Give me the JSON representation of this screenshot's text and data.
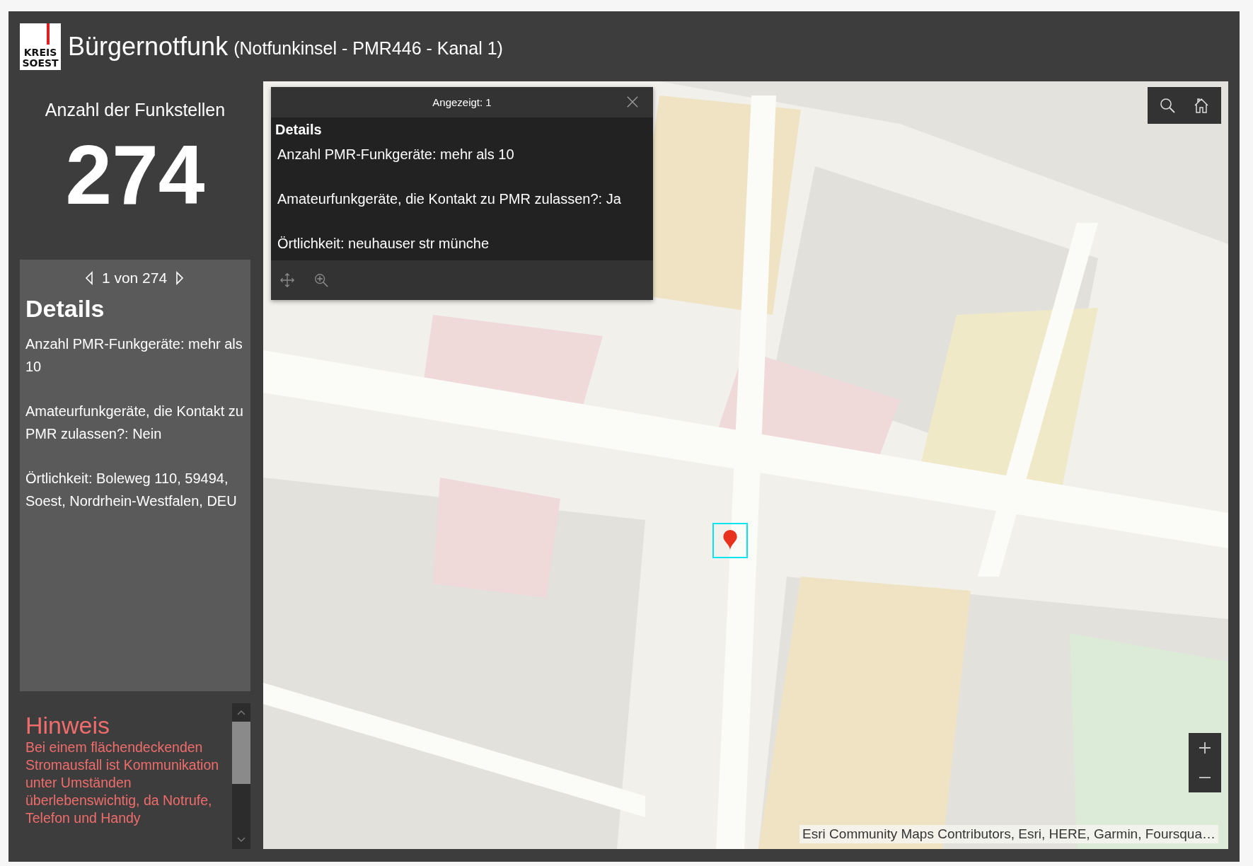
{
  "header": {
    "logo": {
      "line_1": "KREIS",
      "line_2": "SOEST"
    },
    "title": "Bürgernotfunk",
    "subtitle": "(Notfunkinsel - PMR446 - Kanal 1)"
  },
  "counter": {
    "label": "Anzahl der Funkstellen",
    "value": "274"
  },
  "details_panel": {
    "pager": "1 von 274",
    "heading": "Details",
    "fields": [
      {
        "text": "Anzahl PMR-Funkgeräte: mehr als 10"
      },
      {
        "text": "Amateurfunkgeräte, die Kontakt zu PMR zulassen?: Nein"
      },
      {
        "text": "Örtlichkeit: Boleweg 110, 59494, Soest, Nordrhein-Westfalen, DEU"
      }
    ]
  },
  "notice": {
    "title": "Hinweis",
    "text": "Bei einem flächendeckenden Stromausfall ist Kommunikation unter Umständen überlebenswichtig, da Notrufe, Telefon und Handy"
  },
  "map": {
    "kind": "picture",
    "popup": {
      "title": "Angezeigt: 1",
      "heading": "Details",
      "fields": [
        {
          "text": "Anzahl PMR-Funkgeräte: mehr als 10"
        },
        {
          "text": "Amateurfunkgeräte, die Kontakt zu PMR zulassen?: Ja"
        },
        {
          "text": "Örtlichkeit: neuhauser str münche"
        }
      ]
    },
    "attribution": "Esri Community Maps Contributors, Esri, HERE, Garmin, Foursqua…"
  }
}
